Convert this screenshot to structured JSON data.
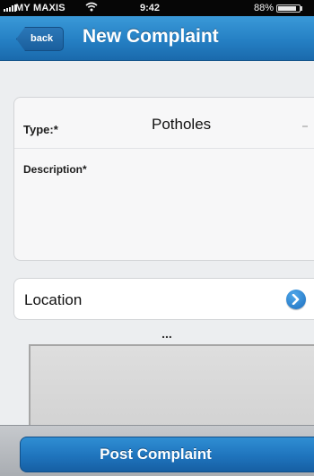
{
  "status_bar": {
    "carrier": "MY MAXIS",
    "wifi_icon": "wifi-icon",
    "time": "9:42",
    "battery_percent": "88%",
    "battery_level": 0.88
  },
  "nav": {
    "back_label": "back",
    "title": "New Complaint"
  },
  "form": {
    "type_label": "Type:*",
    "type_value": "Potholes",
    "description_label": "Description*",
    "description_value": ""
  },
  "location": {
    "label": "Location",
    "disclosure_icon": "chevron-right-circle-icon"
  },
  "more_indicator": "...",
  "toolbar": {
    "post_label": "Post Complaint"
  },
  "colors": {
    "nav_blue": "#2580c4",
    "button_blue": "#1f74bd",
    "background": "#eceef0"
  }
}
